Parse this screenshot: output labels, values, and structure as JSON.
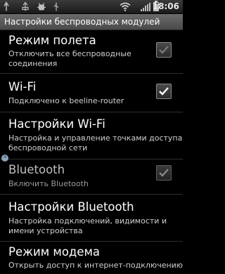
{
  "status_bar": {
    "time": "18:06",
    "icons": [
      "placeholder-icon",
      "usb-icon",
      "debug-icon",
      "wifi-icon",
      "signal-icon",
      "battery-icon"
    ]
  },
  "title_bar": {
    "title": "Настройки беспроводных модулей"
  },
  "items": [
    {
      "title": "Режим полета",
      "subtitle_line1": "Отключить все беспроводные",
      "subtitle_line2": "соединения",
      "checked": false,
      "checkbox": true
    },
    {
      "title": "Wi-Fi",
      "subtitle_line1": "Подключено к beeline-router",
      "checked": true,
      "checkbox": true
    },
    {
      "title": "Настройки Wi-Fi",
      "subtitle_line1": "Настройка и управление точками доступа",
      "subtitle_line2": "беспроводной сети",
      "checkbox": false
    },
    {
      "title": "Bluetooth",
      "subtitle_line1": "Включить Bluetooth",
      "checked": true,
      "checkbox": true,
      "disabled": true
    },
    {
      "title": "Настройки Bluetooth",
      "subtitle_line1": "Настройка подключений, видимости и",
      "subtitle_line2": "имени устройства",
      "checkbox": false
    },
    {
      "title": "Режим модема",
      "subtitle_line1": "Открыть доступ к интернет-подключению",
      "checkbox": false
    }
  ],
  "colors": {
    "background": "#000000",
    "title_bar": "#5a5a5a",
    "divider": "#2e2e2e"
  }
}
